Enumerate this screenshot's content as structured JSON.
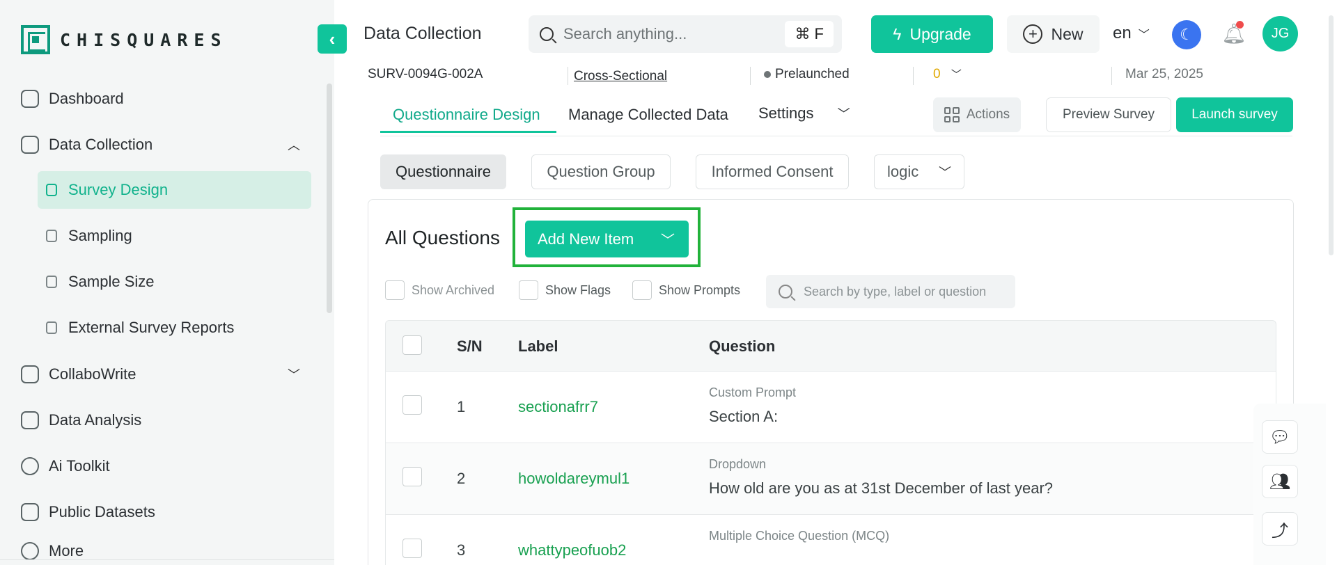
{
  "app": {
    "logo_text": "CHISQUARES",
    "accent_color": "#10c49b"
  },
  "sidebar": {
    "items": [
      {
        "label": "Dashboard",
        "icon": "home-icon"
      },
      {
        "label": "Data Collection",
        "icon": "clipboard-icon",
        "expanded": true
      },
      {
        "label": "CollaboWrite",
        "icon": "chart-icon"
      },
      {
        "label": "Data Analysis",
        "icon": "analysis-icon"
      },
      {
        "label": "Ai Toolkit",
        "icon": "sparkle-icon"
      },
      {
        "label": "Public Datasets",
        "icon": "book-icon"
      },
      {
        "label": "More",
        "icon": "more-icon"
      }
    ],
    "sub_items": [
      {
        "label": "Survey Design",
        "active": true
      },
      {
        "label": "Sampling"
      },
      {
        "label": "Sample Size"
      },
      {
        "label": "External Survey Reports"
      }
    ]
  },
  "header": {
    "title": "Data Collection",
    "search_placeholder": "Search anything...",
    "shortcut": "⌘ F",
    "upgrade_label": "Upgrade",
    "new_label": "New",
    "language": "en",
    "avatar_initials": "JG"
  },
  "meta": {
    "survey_id": "SURV-0094G-002A",
    "study_type": "Cross-Sectional",
    "status": "Prelaunched",
    "count": "0",
    "date": "Mar 25, 2025"
  },
  "tabs": {
    "items": [
      "Questionnaire Design",
      "Manage Collected Data",
      "Settings"
    ],
    "actions_label": "Actions",
    "preview_label": "Preview Survey",
    "launch_label": "Launch survey"
  },
  "subtabs": [
    "Questionnaire",
    "Question Group",
    "Informed Consent",
    "logic"
  ],
  "questions": {
    "heading": "All Questions",
    "add_label": "Add New Item",
    "filters": [
      "Show Archived",
      "Show Flags",
      "Show Prompts"
    ],
    "search_placeholder": "Search by type, label or question",
    "columns": [
      "S/N",
      "Label",
      "Question"
    ],
    "rows": [
      {
        "sn": "1",
        "label": "sectionafrr7",
        "type": "Custom Prompt",
        "question": "Section A:"
      },
      {
        "sn": "2",
        "label": "howoldareymul1",
        "type": "Dropdown",
        "question": "How old are you as at 31st December of last year?"
      },
      {
        "sn": "3",
        "label": "whattypeofuob2",
        "type": "Multiple Choice Question (MCQ)",
        "question": ""
      }
    ]
  }
}
